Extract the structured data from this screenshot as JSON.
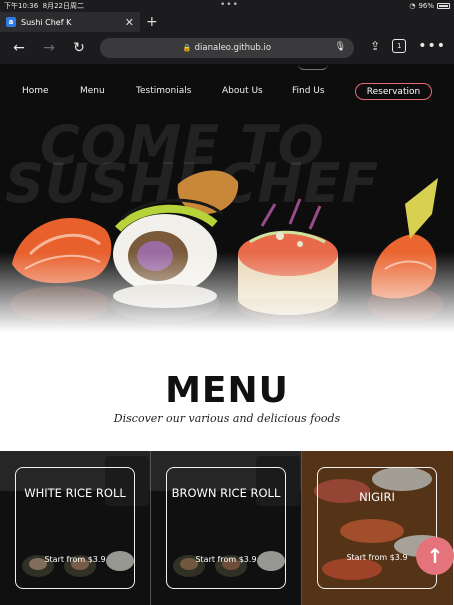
{
  "status_bar": {
    "time": "下午10:36",
    "date": "8月22日周二",
    "dots": "•••",
    "battery": "96%"
  },
  "browser": {
    "tab_title": "Sushi Chef K",
    "favicon_letter": "a",
    "url": "dianaleo.github.io",
    "tab_count": "1"
  },
  "nav": {
    "items": [
      "Home",
      "Menu",
      "Testimonials",
      "About Us",
      "Find Us"
    ],
    "reservation": "Reservation"
  },
  "hero": {
    "bg_line1": "COME TO",
    "bg_line2": "SUSHI CHEF"
  },
  "menu": {
    "title": "MENU",
    "subtitle": "Discover our various and delicious foods"
  },
  "cards": [
    {
      "title": "WHITE RICE ROLL",
      "price": "Start from $3.9"
    },
    {
      "title": "BROWN RICE ROLL",
      "price": "Start from $3.9"
    },
    {
      "title": "NIGIRI",
      "price": "Start from $3.9"
    }
  ],
  "colors": {
    "accent": "#e5737b",
    "dark": "#1c1c1e"
  }
}
